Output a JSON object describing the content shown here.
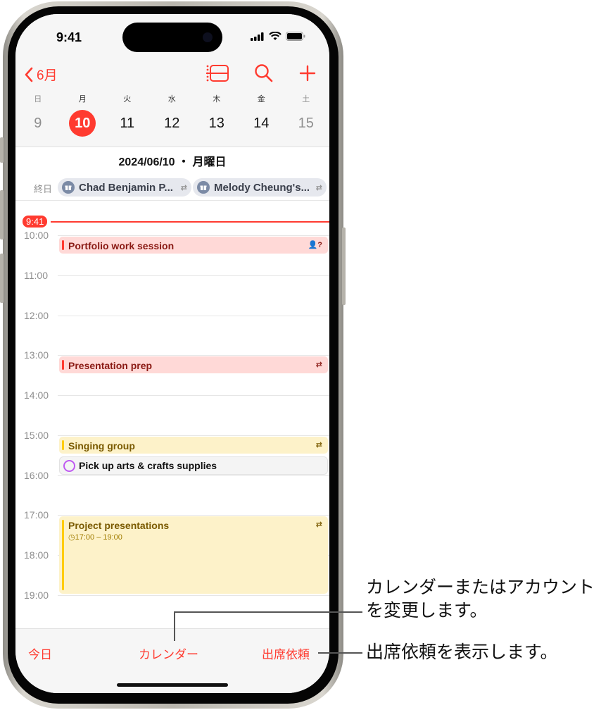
{
  "status_bar": {
    "time": "9:41"
  },
  "nav": {
    "back_label": "6月",
    "icons": [
      "list-view-icon",
      "search-icon",
      "add-icon"
    ]
  },
  "week": {
    "days": [
      {
        "dow": "日",
        "date": "9",
        "weekend": true
      },
      {
        "dow": "月",
        "date": "10",
        "selected": true
      },
      {
        "dow": "火",
        "date": "11"
      },
      {
        "dow": "水",
        "date": "12"
      },
      {
        "dow": "木",
        "date": "13"
      },
      {
        "dow": "金",
        "date": "14"
      },
      {
        "dow": "土",
        "date": "15",
        "weekend": true
      }
    ]
  },
  "day_title": "2024/06/10 ・ 月曜日",
  "all_day": {
    "label": "終日",
    "events": [
      {
        "title": "Chad Benjamin P...",
        "icon": "gift-icon",
        "repeat": true
      },
      {
        "title": "Melody Cheung's...",
        "icon": "gift-icon",
        "repeat": true
      }
    ]
  },
  "now_indicator": "9:41",
  "hours": [
    "10:00",
    "11:00",
    "12:00",
    "13:00",
    "14:00",
    "15:00",
    "16:00",
    "17:00",
    "18:00",
    "19:00"
  ],
  "events": [
    {
      "title": "Portfolio work session",
      "color": "red",
      "icon": "invitee-pending-icon"
    },
    {
      "title": "Presentation prep",
      "color": "red",
      "icon": "repeat-icon"
    },
    {
      "title": "Singing group",
      "color": "yellow",
      "icon": "repeat-icon"
    },
    {
      "title": "Project presentations",
      "color": "yellow",
      "icon": "repeat-icon",
      "time": "17:00 – 19:00"
    }
  ],
  "reminder": {
    "title": "Pick up arts & crafts supplies"
  },
  "tabbar": {
    "today": "今日",
    "calendars": "カレンダー",
    "inbox": "出席依頼"
  },
  "callouts": {
    "calendars": "カレンダーまたはアカウントを変更します。",
    "calendars_line1": "カレンダーまたはアカウント",
    "calendars_line2": "を変更します。",
    "inbox": "出席依頼を表示します。"
  },
  "colors": {
    "accent": "#ff3b30",
    "yellow": "#ffcc00",
    "reminder": "#bf5af2"
  }
}
